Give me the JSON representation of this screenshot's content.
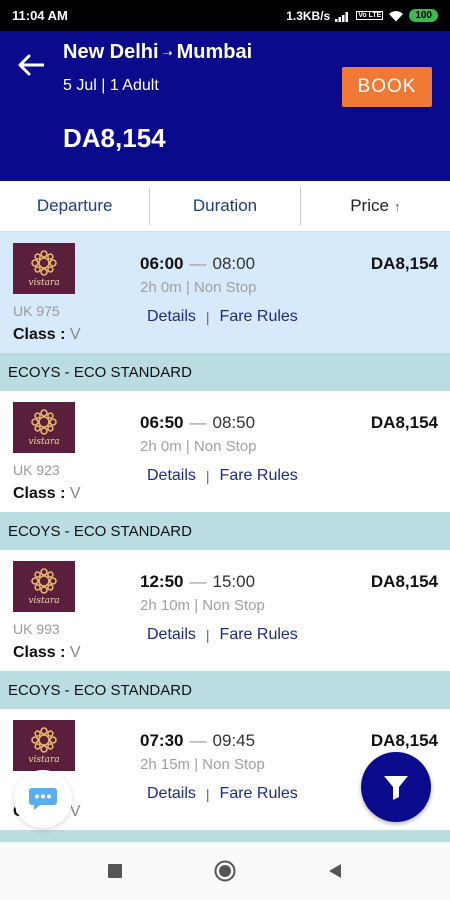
{
  "status": {
    "time": "11:04 AM",
    "network": "1.3KB/s",
    "volte": "Vo LTE",
    "battery": "100"
  },
  "header": {
    "origin": "New Delhi",
    "destination": "Mumbai",
    "trip_meta": "5 Jul | 1 Adult",
    "price": "DA8,154",
    "book_label": "BOOK",
    "colors": {
      "header_bg": "#0a0a8c",
      "book_bg": "#f07a35"
    }
  },
  "sort": {
    "departure": "Departure",
    "duration": "Duration",
    "price": "Price",
    "price_icon": "arrow-up-icon"
  },
  "flights": [
    {
      "logo_text": "vistara",
      "flight_no": "UK 975",
      "class_label": "Class :",
      "class_value": "V",
      "dep": "06:00",
      "arr": "08:00",
      "duration": "2h 0m | Non Stop",
      "price": "DA8,154",
      "details": "Details",
      "fare_rules": "Fare Rules",
      "fare_type": "ECOYS - ECO STANDARD"
    },
    {
      "logo_text": "vistara",
      "flight_no": "UK 923",
      "class_label": "Class :",
      "class_value": "V",
      "dep": "06:50",
      "arr": "08:50",
      "duration": "2h 0m | Non Stop",
      "price": "DA8,154",
      "details": "Details",
      "fare_rules": "Fare Rules",
      "fare_type": "ECOYS - ECO STANDARD"
    },
    {
      "logo_text": "vistara",
      "flight_no": "UK 993",
      "class_label": "Class :",
      "class_value": "V",
      "dep": "12:50",
      "arr": "15:00",
      "duration": "2h 10m | Non Stop",
      "price": "DA8,154",
      "details": "Details",
      "fare_rules": "Fare Rules",
      "fare_type": "ECOYS - ECO STANDARD"
    },
    {
      "logo_text": "vistara",
      "flight_no": "",
      "class_label": "Class :",
      "class_value": "V",
      "dep": "07:30",
      "arr": "09:45",
      "duration": "2h 15m | Non Stop",
      "price": "DA8,154",
      "details": "Details",
      "fare_rules": "Fare Rules",
      "fare_type": ""
    }
  ],
  "selected_flight_index": 0,
  "fabs": {
    "chat_icon": "chat-bubble-icon",
    "filter_icon": "filter-funnel-icon"
  }
}
